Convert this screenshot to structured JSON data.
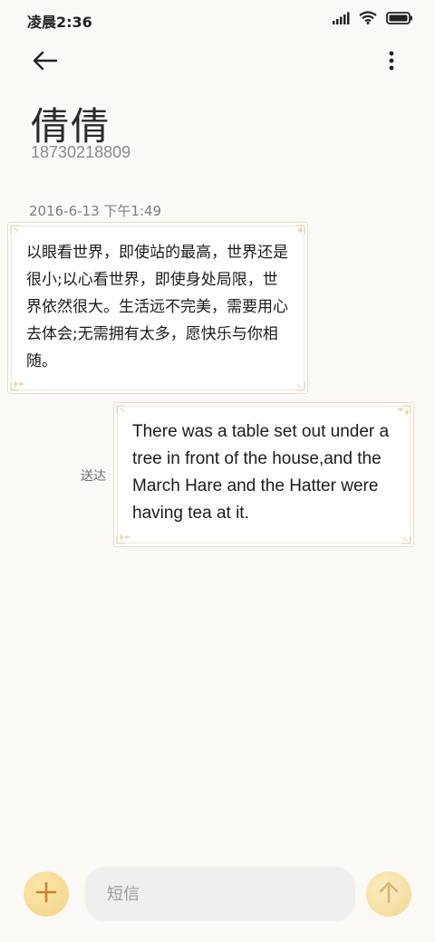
{
  "status_bar": {
    "time": "凌晨2:36",
    "icons": [
      "signal-icon",
      "wifi-icon",
      "battery-icon"
    ]
  },
  "header": {
    "back_icon": "arrow-left-icon",
    "more_icon": "more-vertical-icon"
  },
  "contact": {
    "name": "倩倩",
    "number": "18730218809"
  },
  "conversation": {
    "timestamp": "2016-6-13 下午1:49",
    "messages": [
      {
        "direction": "incoming",
        "text": "以眼看世界，即使站的最高，世界还是很小;以心看世界，即使身处局限，世界依然很大。生活远不完美，需要用心去体会;无需拥有太多，愿快乐与你相随。"
      },
      {
        "direction": "outgoing",
        "text": "There was a table set out under a tree in front of the house,and the March Hare and the Hatter were having tea at it.",
        "status": "送达"
      }
    ]
  },
  "composer": {
    "placeholder": "短信",
    "add_icon": "plus-icon",
    "send_icon": "arrow-up-icon"
  },
  "colors": {
    "background": "#faf9f6",
    "bubble_border": "#e8dcc4",
    "accent_gold": "#f2d58a",
    "accent_icon": "#c9822f",
    "input_bg": "#efefef"
  }
}
